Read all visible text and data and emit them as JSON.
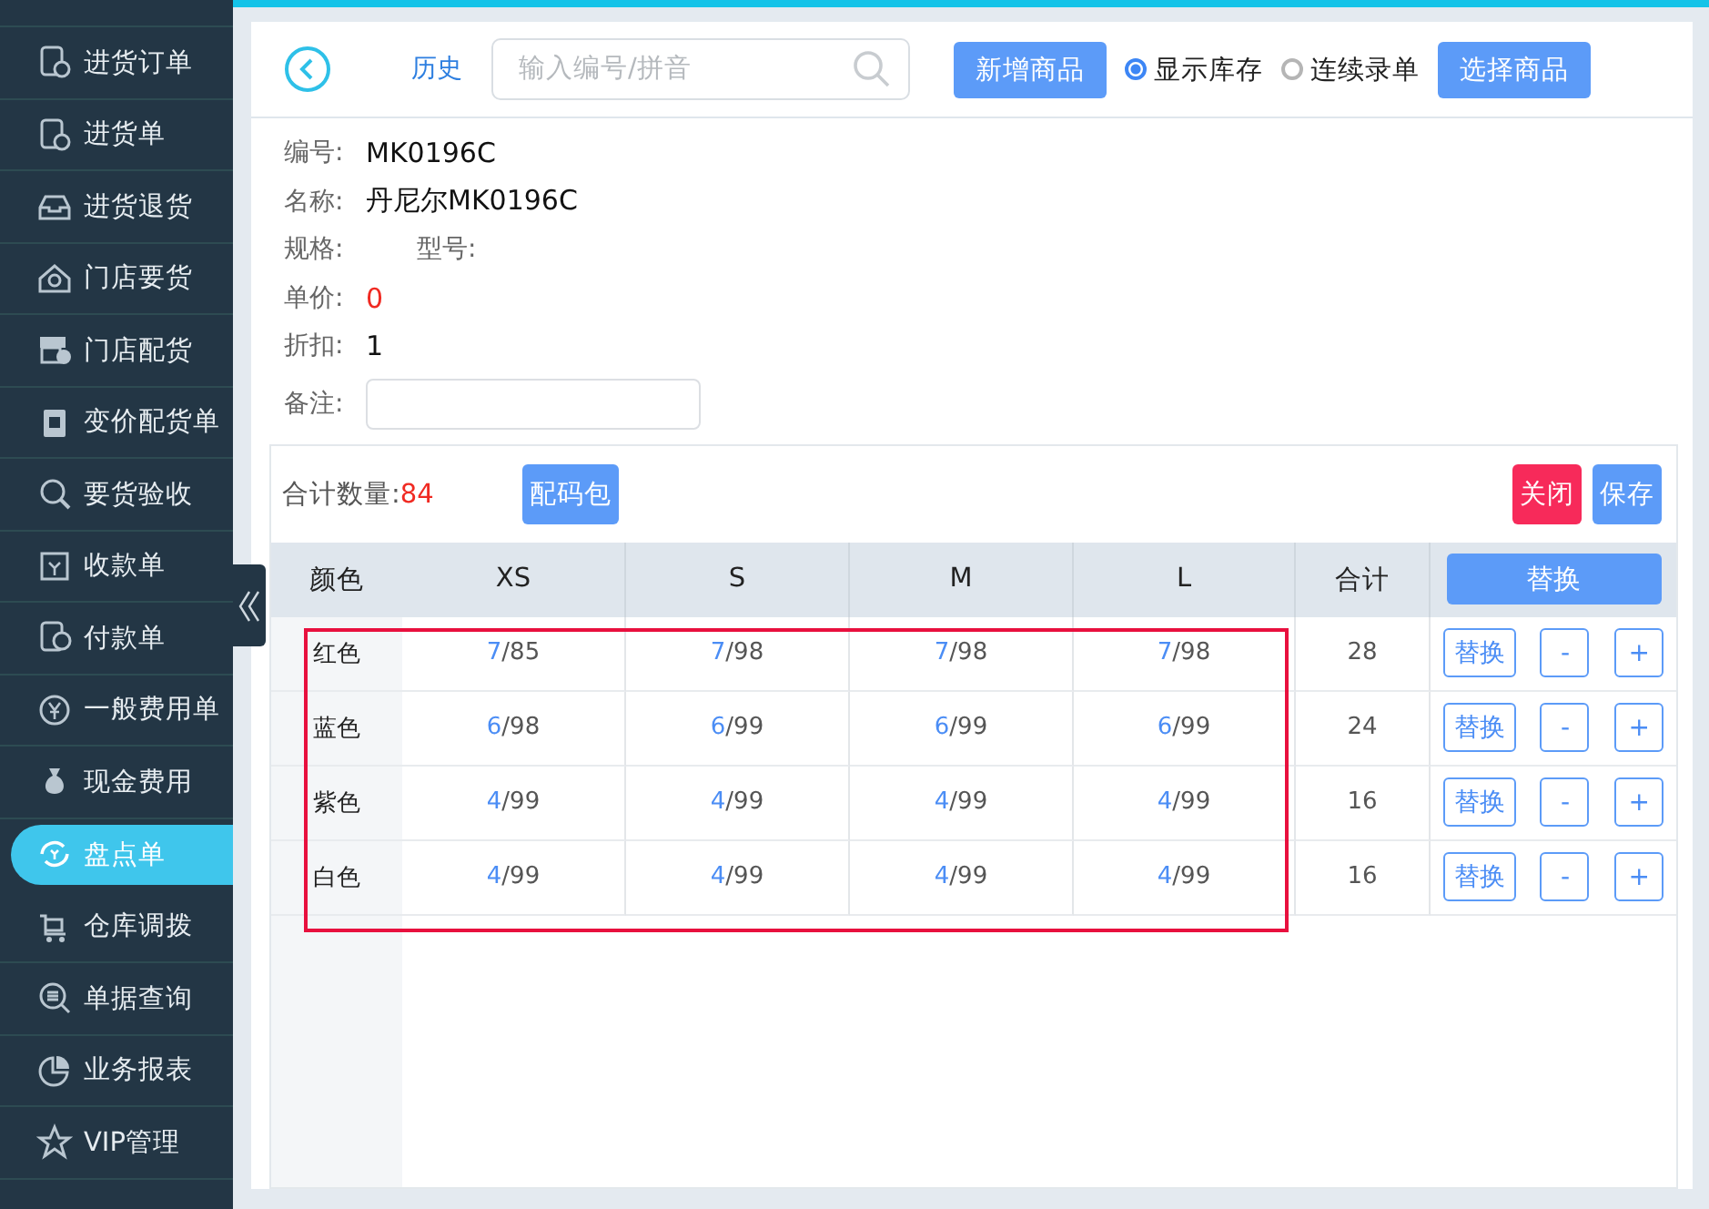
{
  "sidebar": {
    "items": [
      {
        "label": "进货订单",
        "selected": false
      },
      {
        "label": "进货单",
        "selected": false
      },
      {
        "label": "进货退货",
        "selected": false
      },
      {
        "label": "门店要货",
        "selected": false
      },
      {
        "label": "门店配货",
        "selected": false
      },
      {
        "label": "变价配货单",
        "selected": false
      },
      {
        "label": "要货验收",
        "selected": false
      },
      {
        "label": "收款单",
        "selected": false
      },
      {
        "label": "付款单",
        "selected": false
      },
      {
        "label": "一般费用单",
        "selected": false
      },
      {
        "label": "现金费用",
        "selected": false
      },
      {
        "label": "盘点单",
        "selected": true
      },
      {
        "label": "仓库调拨",
        "selected": false
      },
      {
        "label": "单据查询",
        "selected": false
      },
      {
        "label": "业务报表",
        "selected": false
      },
      {
        "label": "VIP管理",
        "selected": false
      }
    ]
  },
  "toolbar": {
    "history": "历史",
    "search": {
      "placeholder": "输入编号/拼音"
    },
    "add_button": "新增商品",
    "radios": [
      {
        "label": "显示库存",
        "selected": true
      },
      {
        "label": "连续录单",
        "selected": false
      }
    ],
    "select_button": "选择商品"
  },
  "product": {
    "fields": [
      {
        "label": "编号:",
        "value": "MK0196C"
      },
      {
        "label": "名称:",
        "value": "丹尼尔MK0196C"
      },
      {
        "label": "规格:",
        "extra_label": "型号:"
      },
      {
        "label": "单价:",
        "value": "0",
        "alert": true
      },
      {
        "label": "折扣:",
        "value": "1"
      }
    ],
    "note_label": "备注:"
  },
  "summary": {
    "label": "合计数量:",
    "value": "84",
    "pack_button": "配码包",
    "close_button": "关闭",
    "save_button": "保存"
  },
  "table": {
    "highlighted": true,
    "columns": [
      "颜色",
      "XS",
      "S",
      "M",
      "L",
      "合计"
    ],
    "header_button": "替换",
    "rows": [
      {
        "cells": [
          {
            "kind": "name",
            "text": "红色"
          },
          {
            "kind": "qty",
            "qty": "7",
            "stock": "/85"
          },
          {
            "kind": "qty",
            "qty": "7",
            "stock": "/98"
          },
          {
            "kind": "qty",
            "qty": "7",
            "stock": "/98"
          },
          {
            "kind": "qty",
            "qty": "7",
            "stock": "/98"
          },
          {
            "kind": "total",
            "text": "28"
          }
        ],
        "actions": [
          "替换",
          "-",
          "+"
        ]
      },
      {
        "cells": [
          {
            "kind": "name",
            "text": "蓝色"
          },
          {
            "kind": "qty",
            "qty": "6",
            "stock": "/98"
          },
          {
            "kind": "qty",
            "qty": "6",
            "stock": "/99"
          },
          {
            "kind": "qty",
            "qty": "6",
            "stock": "/99"
          },
          {
            "kind": "qty",
            "qty": "6",
            "stock": "/99"
          },
          {
            "kind": "total",
            "text": "24"
          }
        ],
        "actions": [
          "替换",
          "-",
          "+"
        ]
      },
      {
        "cells": [
          {
            "kind": "name",
            "text": "紫色"
          },
          {
            "kind": "qty",
            "qty": "4",
            "stock": "/99"
          },
          {
            "kind": "qty",
            "qty": "4",
            "stock": "/99"
          },
          {
            "kind": "qty",
            "qty": "4",
            "stock": "/99"
          },
          {
            "kind": "qty",
            "qty": "4",
            "stock": "/99"
          },
          {
            "kind": "total",
            "text": "16"
          }
        ],
        "actions": [
          "替换",
          "-",
          "+"
        ]
      },
      {
        "cells": [
          {
            "kind": "name",
            "text": "白色"
          },
          {
            "kind": "qty",
            "qty": "4",
            "stock": "/99"
          },
          {
            "kind": "qty",
            "qty": "4",
            "stock": "/99"
          },
          {
            "kind": "qty",
            "qty": "4",
            "stock": "/99"
          },
          {
            "kind": "qty",
            "qty": "4",
            "stock": "/99"
          },
          {
            "kind": "total",
            "text": "16"
          }
        ],
        "actions": [
          "替换",
          "-",
          "+"
        ]
      }
    ]
  }
}
